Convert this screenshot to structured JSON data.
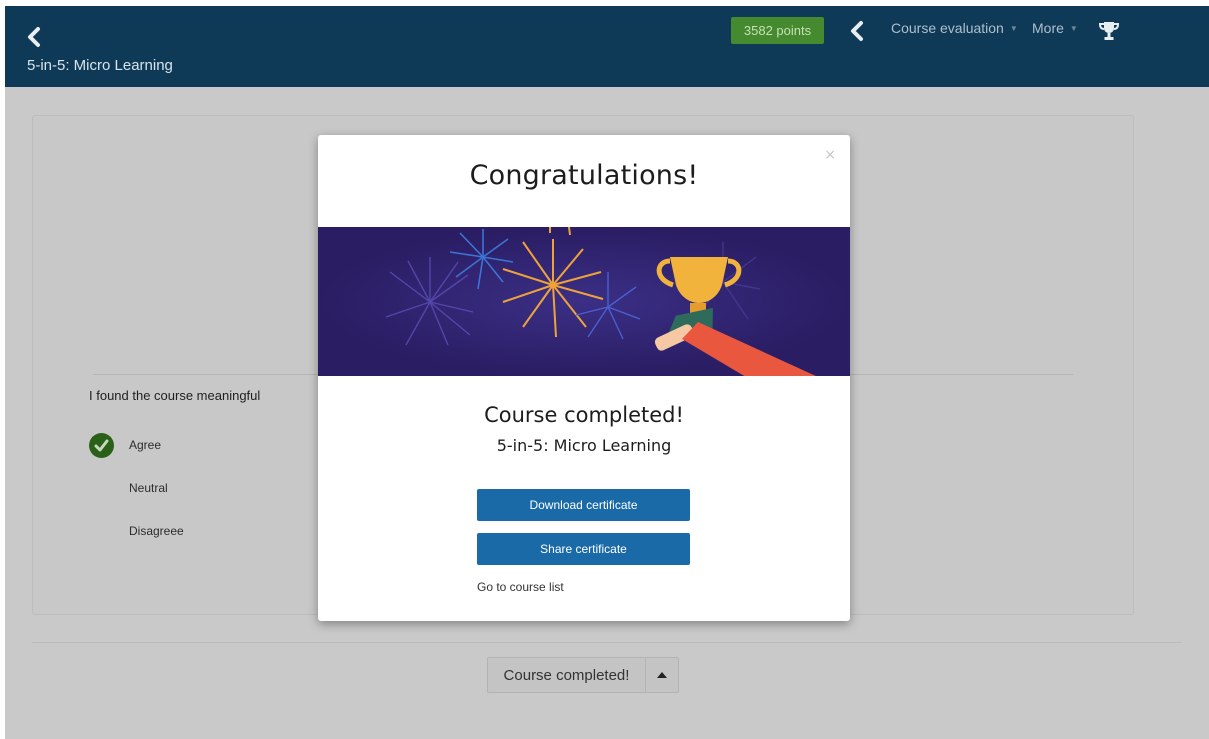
{
  "header": {
    "course_title": "5-in-5: Micro Learning",
    "points": "3582 points",
    "menus": [
      {
        "label": "Course evaluation"
      },
      {
        "label": "More"
      }
    ],
    "icons": {
      "back": "chevron-left-icon",
      "prev": "chevron-left-icon",
      "trophy": "trophy-icon"
    },
    "colors": {
      "bar": "#0f3a57",
      "points_badge": "#468a2f"
    }
  },
  "survey": {
    "question": "I found the course meaningful",
    "options": [
      "Agree",
      "Neutral",
      "Disagreee"
    ],
    "selected": "Agree"
  },
  "footer": {
    "completed_label": "Course completed!",
    "toggle_icon": "caret-up-icon"
  },
  "modal": {
    "close": "×",
    "title": "Congratulations!",
    "subtitle": "Course completed!",
    "course_name": "5-in-5: Micro Learning",
    "download_label": "Download certificate",
    "share_label": "Share certificate",
    "course_list_link": "Go to course list",
    "colors": {
      "button": "#1a6aa7",
      "banner": "#2a1d63"
    }
  }
}
